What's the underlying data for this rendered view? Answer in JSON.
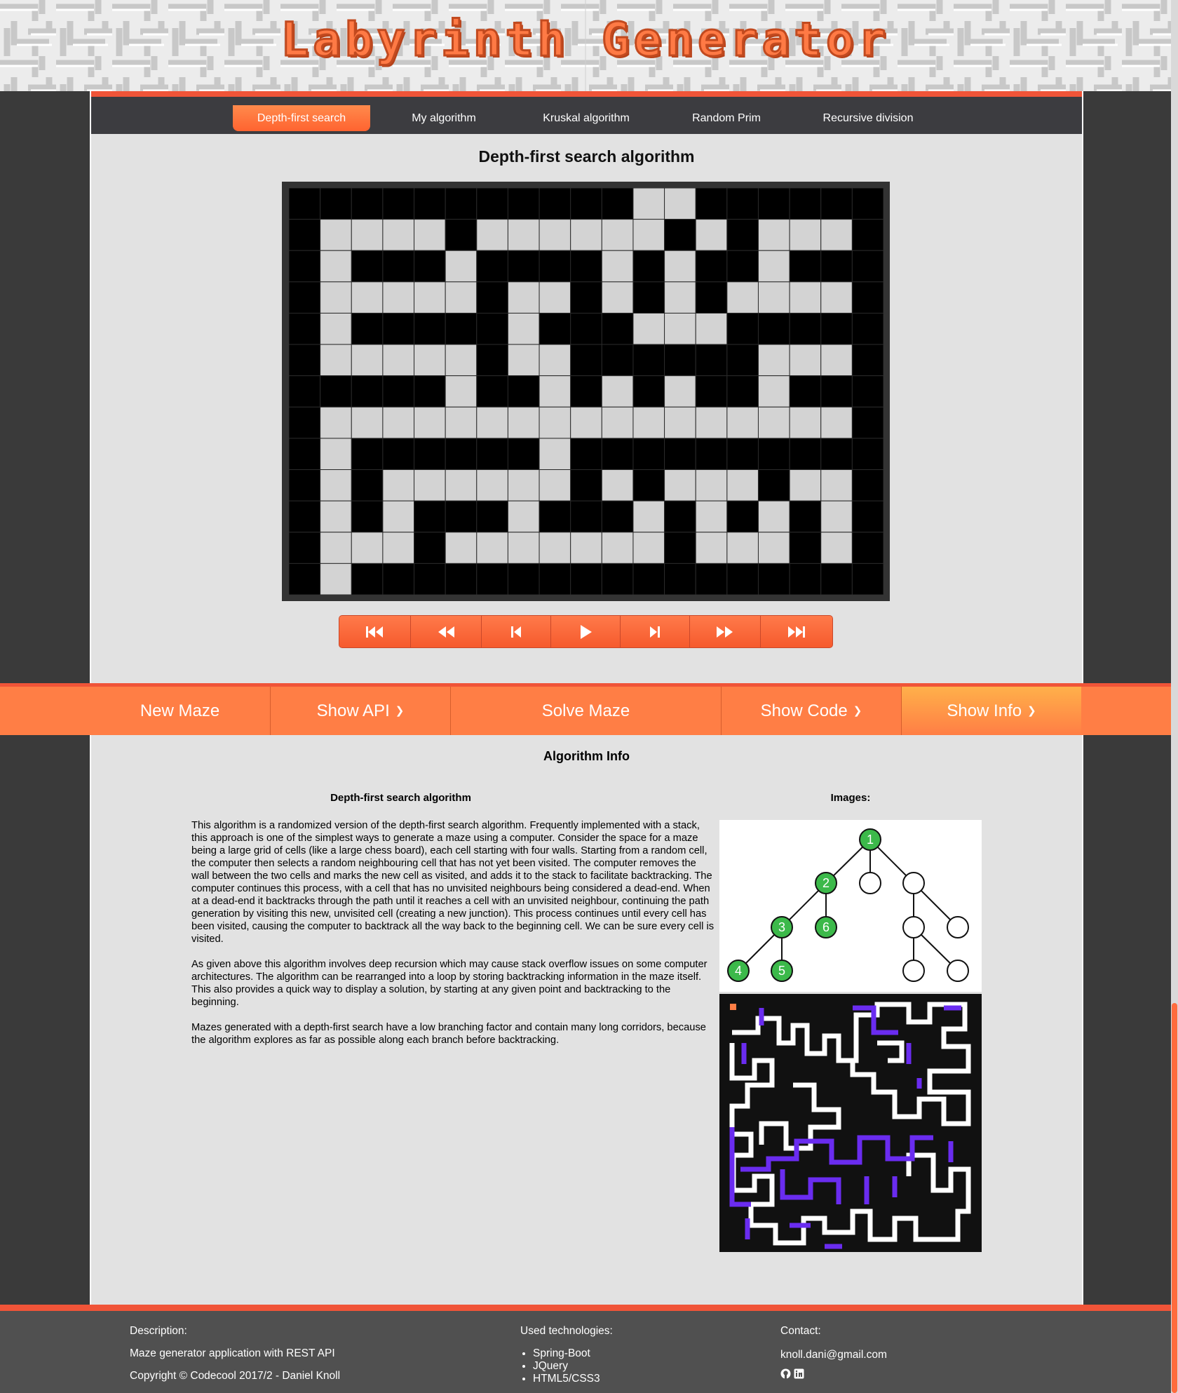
{
  "site": {
    "title": "Labyrinth Generator"
  },
  "nav": {
    "tabs": [
      "Depth-first search",
      "My algorithm",
      "Kruskal algorithm",
      "Random Prim",
      "Recursive division"
    ],
    "active": 0
  },
  "main": {
    "algo_title": "Depth-first search algorithm"
  },
  "maze": {
    "rows": [
      "###########.######",
      "#....#......#.#....#",
      "#.###.####.#.##.###",
      "#.....#..#.#.#....#",
      "#.#####.###...#####.#",
      "#.....#..######....#",
      "#####.##.#.#.##.###",
      "#.........................#",
      "#.######.#########.#",
      "#.#......#.#...#...#",
      "#.#.###.###.#.#.#.#",
      "#...#.......#...#.#",
      "#.##################"
    ]
  },
  "controls": [
    {
      "name": "first-step-button",
      "icon": "skip-to-start-icon"
    },
    {
      "name": "fast-backward-button",
      "icon": "fast-backward-icon"
    },
    {
      "name": "step-backward-button",
      "icon": "step-backward-icon"
    },
    {
      "name": "play-button",
      "icon": "play-icon"
    },
    {
      "name": "step-forward-button",
      "icon": "step-forward-icon"
    },
    {
      "name": "fast-forward-button",
      "icon": "fast-forward-icon"
    },
    {
      "name": "last-step-button",
      "icon": "skip-to-end-icon"
    }
  ],
  "actions": {
    "new_maze": "New Maze",
    "show_api": "Show API",
    "solve_maze": "Solve Maze",
    "show_code": "Show Code",
    "show_info": "Show Info"
  },
  "info": {
    "title": "Algorithm Info",
    "subtitle": "Depth-first search algorithm",
    "images_title": "Images:",
    "paragraphs": [
      "This algorithm is a randomized version of the depth-first search algorithm. Frequently implemented with a stack, this approach is one of the simplest ways to generate a maze using a computer. Consider the space for a maze being a large grid of cells (like a large chess board), each cell starting with four walls. Starting from a random cell, the computer then selects a random neighbouring cell that has not yet been visited. The computer removes the wall between the two cells and marks the new cell as visited, and adds it to the stack to facilitate backtracking. The computer continues this process, with a cell that has no unvisited neighbours being considered a dead-end. When at a dead-end it backtracks through the path until it reaches a cell with an unvisited neighbour, continuing the path generation by visiting this new, unvisited cell (creating a new junction). This process continues until every cell has been visited, causing the computer to backtrack all the way back to the beginning cell. We can be sure every cell is visited.",
      "As given above this algorithm involves deep recursion which may cause stack overflow issues on some computer architectures. The algorithm can be rearranged into a loop by storing backtracking information in the maze itself. This also provides a quick way to display a solution, by starting at any given point and backtracking to the beginning.",
      "Mazes generated with a depth-first search have a low branching factor and contain many long corridors, because the algorithm explores as far as possible along each branch before backtracking."
    ],
    "tree_nodes": [
      "1",
      "2",
      "3",
      "4",
      "5",
      "6"
    ]
  },
  "footer": {
    "description_label": "Description:",
    "description": "Maze generator application with REST API",
    "copyright": "Copyright © Codecool 2017/2 - Daniel Knoll",
    "tech_label": "Used technologies:",
    "techs": [
      "Spring-Boot",
      "JQuery",
      "HTML5/CSS3"
    ],
    "contact_label": "Contact:",
    "email": "knoll.dani@gmail.com"
  },
  "colors": {
    "accent": "#ff7e45",
    "accent_dark": "#f05438",
    "wall": "#000000",
    "path": "#d3d3d3",
    "node_green": "#3cb94a",
    "maze_purple": "#6a2cf0"
  }
}
